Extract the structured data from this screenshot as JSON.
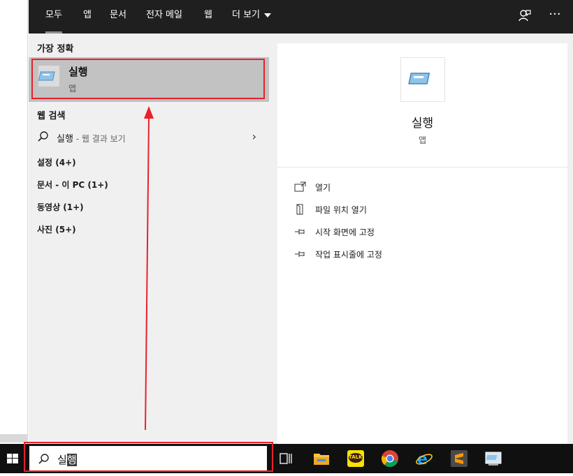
{
  "tabs": [
    "모두",
    "앱",
    "문서",
    "전자 메일",
    "웹",
    "더 보기"
  ],
  "left": {
    "best_match_header": "가장 정확",
    "best_match": {
      "title": "실행",
      "subtitle": "앱"
    },
    "web_search_header": "웹 검색",
    "web_search": {
      "query": "실행",
      "hint": " - 웹 결과 보기"
    },
    "categories": [
      "설정 (4+)",
      "문서 - 이 PC (1+)",
      "동영상 (1+)",
      "사진 (5+)"
    ]
  },
  "right": {
    "title": "실행",
    "subtitle": "앱",
    "actions": [
      "열기",
      "파일 위치 열기",
      "시작 화면에 고정",
      "작업 표시줄에 고정"
    ]
  },
  "taskbar": {
    "search_text": "실",
    "search_selected": "행",
    "apps": [
      "task-view-icon",
      "file-explorer-icon",
      "kakaotalk-icon",
      "chrome-icon",
      "internet-explorer-icon",
      "sublime-text-icon",
      "run-app-icon"
    ],
    "kakao_label": "TALK"
  },
  "colors": {
    "highlight_box": "#e8212c",
    "topbar": "#1f1f1f",
    "selected_row": "#c2c2c2"
  }
}
